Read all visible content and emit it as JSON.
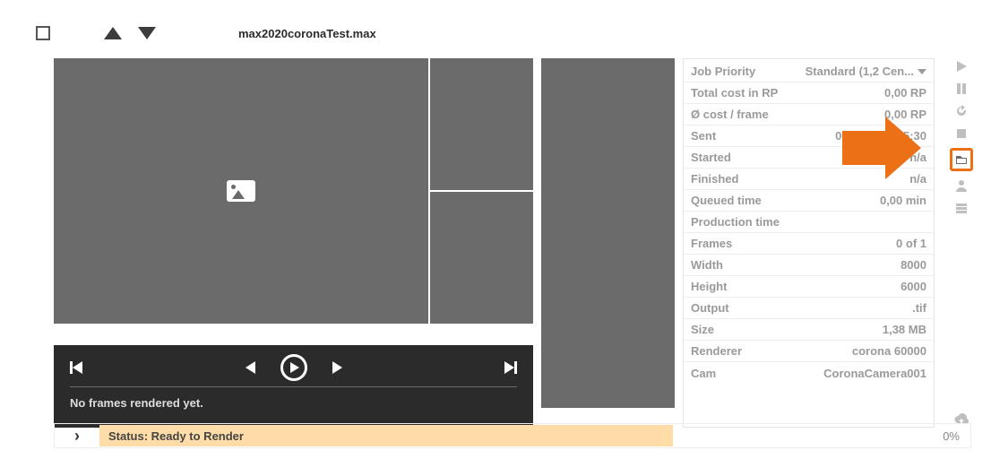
{
  "header": {
    "filename": "max2020coronaTest.max"
  },
  "preview": {
    "message": "No frames rendered yet."
  },
  "info": {
    "priority_label": "Job Priority",
    "priority_value": "Standard (1,2 Cen...",
    "rows": [
      {
        "label": "Total cost in RP",
        "value": "0,00 RP"
      },
      {
        "label": "Ø cost / frame",
        "value": "0,00 RP"
      },
      {
        "label": "Sent",
        "value": "06.04.2020 15:30"
      },
      {
        "label": "Started",
        "value": "n/a"
      },
      {
        "label": "Finished",
        "value": "n/a"
      },
      {
        "label": "Queued time",
        "value": "0,00 min"
      },
      {
        "label": "Production time",
        "value": ""
      },
      {
        "label": "Frames",
        "value": "0 of 1"
      },
      {
        "label": "Width",
        "value": "8000"
      },
      {
        "label": "Height",
        "value": "6000"
      },
      {
        "label": "Output",
        "value": ".tif"
      },
      {
        "label": "Size",
        "value": "1,38 MB"
      },
      {
        "label": "Renderer",
        "value": "corona 60000"
      },
      {
        "label": "Cam",
        "value": "CoronaCamera001"
      }
    ]
  },
  "status": {
    "label": "Status: Ready to Render",
    "percent": "0%"
  }
}
